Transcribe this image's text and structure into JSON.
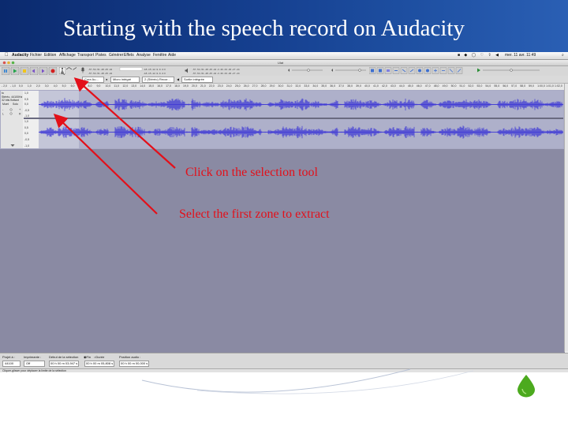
{
  "slide": {
    "title": "Starting with the speech record on Audacity",
    "annotations": {
      "selection_tool": "Click on the selection tool",
      "select_zone": "Select the first zone to extract"
    },
    "colors": {
      "header": "#153f8f",
      "annotation": "#e3101a",
      "workspace": "#8a8aa3",
      "waveform": "#3b35d6",
      "drop": "#4caa1e"
    }
  },
  "menubar": {
    "apple": "",
    "items": [
      "Audacity",
      "Fichier",
      "Edition",
      "Affichage",
      "Transport",
      "Pistes",
      "Générer",
      "Effets",
      "Analyse",
      "Fenêtre",
      "Aide"
    ],
    "clock": "mer. 11 avr.  11:49"
  },
  "window": {
    "title": "Ulat"
  },
  "devices": {
    "host": "Core Au...",
    "input": "Micro intégré",
    "channels": "2 (Stéréo) Recor...",
    "output": "Sortie intégrée"
  },
  "timeline": {
    "ticks": [
      "- 2,0",
      "- 1,0",
      "0,0",
      "1,0",
      "2,0",
      "3,0",
      "4,0",
      "5,0",
      "6,0",
      "7,0",
      "8,0",
      "9,0",
      "10,0",
      "11,0",
      "12,0",
      "13,0",
      "14,0",
      "15,0",
      "16,0",
      "17,0",
      "18,0",
      "19,0",
      "20,0",
      "21,0",
      "22,0",
      "23,0",
      "24,0",
      "25,0",
      "26,0",
      "27,0",
      "28,0",
      "29,0",
      "30,0",
      "31,0",
      "32,0",
      "33,0",
      "34,0",
      "35,0",
      "36,0",
      "37,0",
      "38,0",
      "39,0",
      "40,0",
      "41,0",
      "42,0",
      "43,0",
      "44,0",
      "45,0",
      "46,0",
      "47,0",
      "48,0",
      "49,0",
      "50,0",
      "51,0",
      "52,0",
      "53,0",
      "54,0",
      "55,0",
      "56,0",
      "57,0",
      "58,0",
      "59,0",
      "1:00,0",
      "1:01,0",
      "1:02,0"
    ]
  },
  "track": {
    "name": "tu",
    "info1": "Stéréo, 44100Hz",
    "info2": "32 bits flottant",
    "mute": "Muet",
    "solo": "Solo",
    "scale": [
      "1,0",
      "0,5",
      "0,0",
      "-0,5",
      "-1,0",
      "1,0",
      "0,5",
      "0,0",
      "-0,5",
      "-1,0"
    ]
  },
  "selection_bar": {
    "project_rate_label": "Projet à :",
    "project_rate": "44100",
    "snap_label": "Imprimante :",
    "snap_value": "Off",
    "start_label": "Début de la sélection",
    "end_radio": "Fin",
    "length_radio": "Durée",
    "audio_pos_label": "Position audio :",
    "start_value": "00 h 00 m 03,947 s",
    "end_value": "00 h 00 m 05,808 s",
    "audio_pos_value": "00 h 00 m 00,000 s",
    "status": "Cliquer-glisser pour déplacer la limite de la sélection"
  }
}
